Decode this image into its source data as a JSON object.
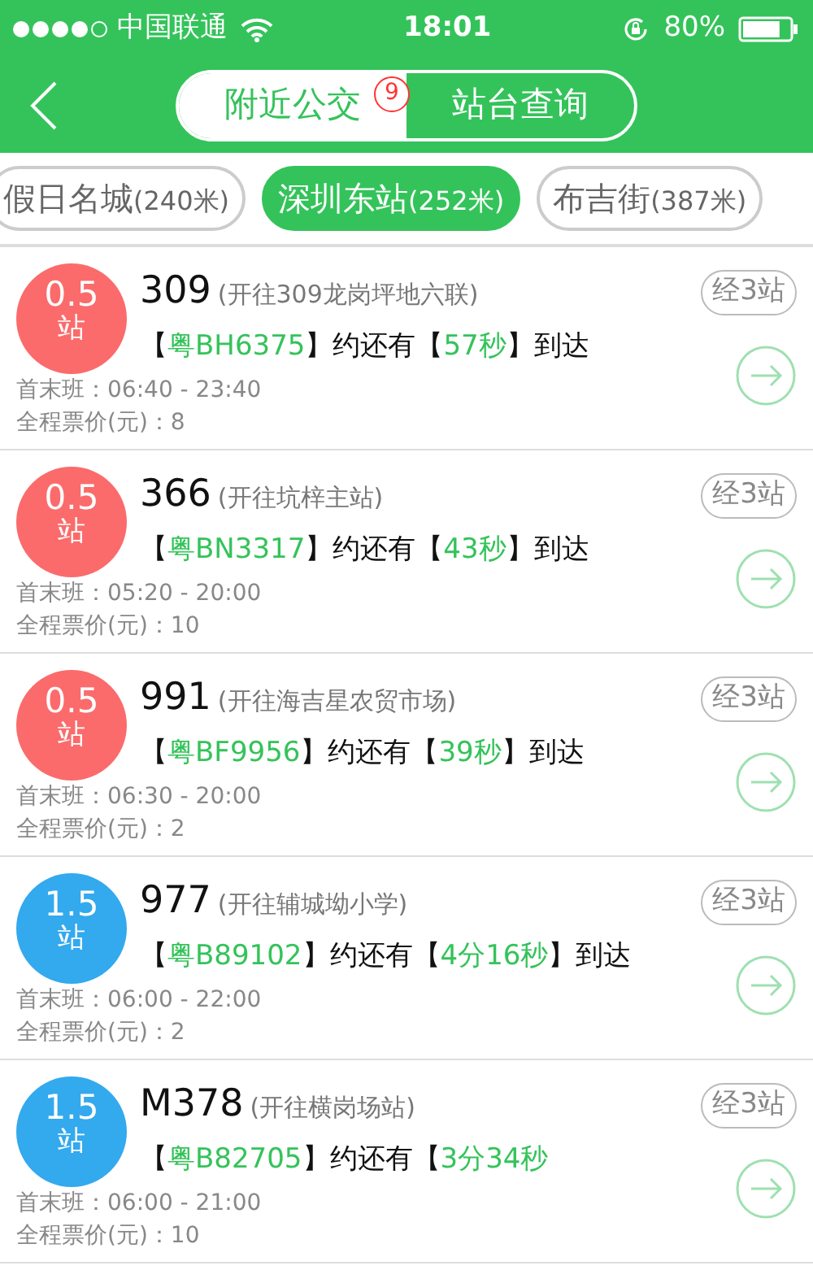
{
  "status_bar": {
    "carrier": "中国联通",
    "time": "18:01",
    "battery": "80%",
    "signal_dots": [
      {
        "on": true
      },
      {
        "on": true
      },
      {
        "on": true
      },
      {
        "on": true
      },
      {
        "on": false
      }
    ]
  },
  "header": {
    "tabs": [
      {
        "label": "附近公交",
        "selected": true,
        "badge": "9"
      },
      {
        "label": "站台查询",
        "selected": false
      }
    ]
  },
  "stops": [
    {
      "name": "假日名城",
      "distance": "(240米)",
      "selected": false
    },
    {
      "name": "深圳东站",
      "distance": "(252米)",
      "selected": true
    },
    {
      "name": "布吉街",
      "distance": "(387米)",
      "selected": false
    }
  ],
  "routes": [
    {
      "stops_away": "0.5",
      "unit": "站",
      "color": "#fb6b6b",
      "number": "309",
      "direction": "(开往309龙岗坪地六联)",
      "via": "经3站",
      "arrival": [
        {
          "kind": "plain",
          "text": "【"
        },
        {
          "kind": "highlight",
          "text": "粤BH6375"
        },
        {
          "kind": "plain",
          "text": "】约还有【"
        },
        {
          "kind": "highlight",
          "text": "57秒"
        },
        {
          "kind": "plain",
          "text": "】到达"
        }
      ],
      "hours": "首末班：06:40 - 23:40",
      "fare": "全程票价(元)：8"
    },
    {
      "stops_away": "0.5",
      "unit": "站",
      "color": "#fb6b6b",
      "number": "366",
      "direction": "(开往坑梓主站)",
      "via": "经3站",
      "arrival": [
        {
          "kind": "plain",
          "text": "【"
        },
        {
          "kind": "highlight",
          "text": "粤BN3317"
        },
        {
          "kind": "plain",
          "text": "】约还有【"
        },
        {
          "kind": "highlight",
          "text": "43秒"
        },
        {
          "kind": "plain",
          "text": "】到达"
        }
      ],
      "hours": "首末班：05:20 - 20:00",
      "fare": "全程票价(元)：10"
    },
    {
      "stops_away": "0.5",
      "unit": "站",
      "color": "#fb6b6b",
      "number": "991",
      "direction": "(开往海吉星农贸市场)",
      "via": "经3站",
      "arrival": [
        {
          "kind": "plain",
          "text": "【"
        },
        {
          "kind": "highlight",
          "text": "粤BF9956"
        },
        {
          "kind": "plain",
          "text": "】约还有【"
        },
        {
          "kind": "highlight",
          "text": "39秒"
        },
        {
          "kind": "plain",
          "text": "】到达"
        }
      ],
      "hours": "首末班：06:30 - 20:00",
      "fare": "全程票价(元)：2"
    },
    {
      "stops_away": "1.5",
      "unit": "站",
      "color": "#33a9ee",
      "number": "977",
      "direction": "(开往辅城坳小学)",
      "via": "经3站",
      "arrival": [
        {
          "kind": "plain",
          "text": "【"
        },
        {
          "kind": "highlight",
          "text": "粤B89102"
        },
        {
          "kind": "plain",
          "text": "】约还有【"
        },
        {
          "kind": "highlight",
          "text": "4分16秒"
        },
        {
          "kind": "plain",
          "text": "】到达"
        }
      ],
      "hours": "首末班：06:00 - 22:00",
      "fare": "全程票价(元)：2"
    },
    {
      "stops_away": "1.5",
      "unit": "站",
      "color": "#33a9ee",
      "number": "M378",
      "direction": "(开往横岗场站)",
      "via": "经3站",
      "arrival": [
        {
          "kind": "plain",
          "text": "【"
        },
        {
          "kind": "highlight",
          "text": "粤B82705"
        },
        {
          "kind": "plain",
          "text": "】约还有【"
        },
        {
          "kind": "highlight",
          "text": "3分34秒"
        }
      ],
      "hours": "首末班：06:00 - 21:00",
      "fare": "全程票价(元)：10"
    }
  ]
}
